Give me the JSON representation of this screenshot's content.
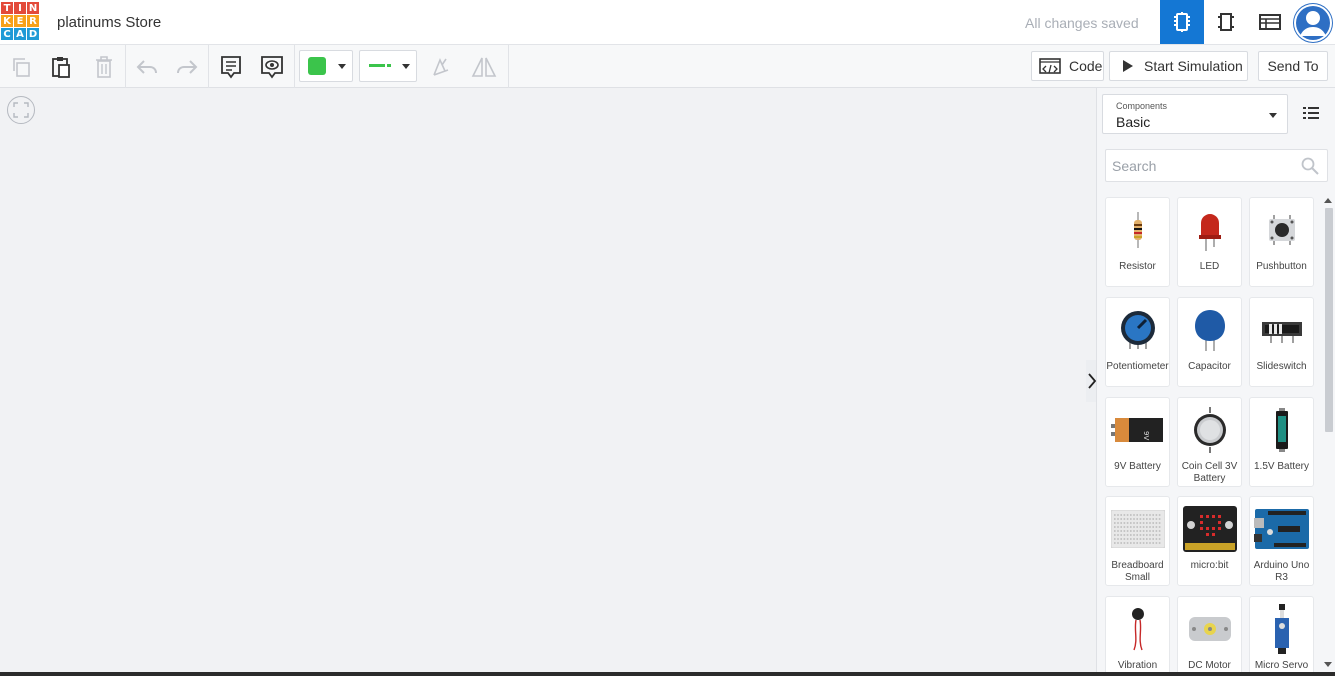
{
  "header": {
    "logo_letters": [
      "T",
      "I",
      "N",
      "K",
      "E",
      "R",
      "C",
      "A",
      "D"
    ],
    "logo_colors": [
      "#e34a3a",
      "#e34a3a",
      "#e34a3a",
      "#f7a11a",
      "#f7a11a",
      "#f7a11a",
      "#1f9ad6",
      "#1f9ad6",
      "#1f9ad6"
    ],
    "project_title": "platinums Store",
    "save_status": "All changes saved",
    "view_buttons": [
      "circuit-view-icon",
      "schematic-view-icon",
      "component-list-view-icon"
    ],
    "active_view": "circuit-view-icon",
    "accent": "#1477d4"
  },
  "toolbar": {
    "icons": [
      "copy-icon",
      "paste-icon",
      "delete-icon",
      "undo-icon",
      "redo-icon",
      "notes-icon",
      "notes-visibility-icon",
      "rotate-icon",
      "flip-icon"
    ],
    "fill_color": "#3bc44b",
    "wire_color": "#3bc44b",
    "code_label": "Code",
    "start_simulation_label": "Start Simulation",
    "send_to_label": "Send To"
  },
  "panel": {
    "select_caption": "Components",
    "select_value": "Basic",
    "search_placeholder": "Search",
    "components": [
      {
        "name": "Resistor",
        "icon": "resistor-icon"
      },
      {
        "name": "LED",
        "icon": "led-icon"
      },
      {
        "name": "Pushbutton",
        "icon": "pushbutton-icon"
      },
      {
        "name": "Potentiometer",
        "icon": "potentiometer-icon"
      },
      {
        "name": "Capacitor",
        "icon": "capacitor-icon"
      },
      {
        "name": "Slideswitch",
        "icon": "slideswitch-icon"
      },
      {
        "name": "9V Battery",
        "icon": "battery-9v-icon"
      },
      {
        "name": "Coin Cell 3V Battery",
        "icon": "coin-cell-icon"
      },
      {
        "name": "1.5V Battery",
        "icon": "battery-aa-icon"
      },
      {
        "name": "Breadboard Small",
        "icon": "breadboard-icon"
      },
      {
        "name": "micro:bit",
        "icon": "microbit-icon"
      },
      {
        "name": "Arduino Uno R3",
        "icon": "arduino-icon"
      },
      {
        "name": "Vibration",
        "icon": "vibration-motor-icon"
      },
      {
        "name": "DC Motor",
        "icon": "dc-motor-icon"
      },
      {
        "name": "Micro Servo",
        "icon": "micro-servo-icon"
      }
    ]
  }
}
